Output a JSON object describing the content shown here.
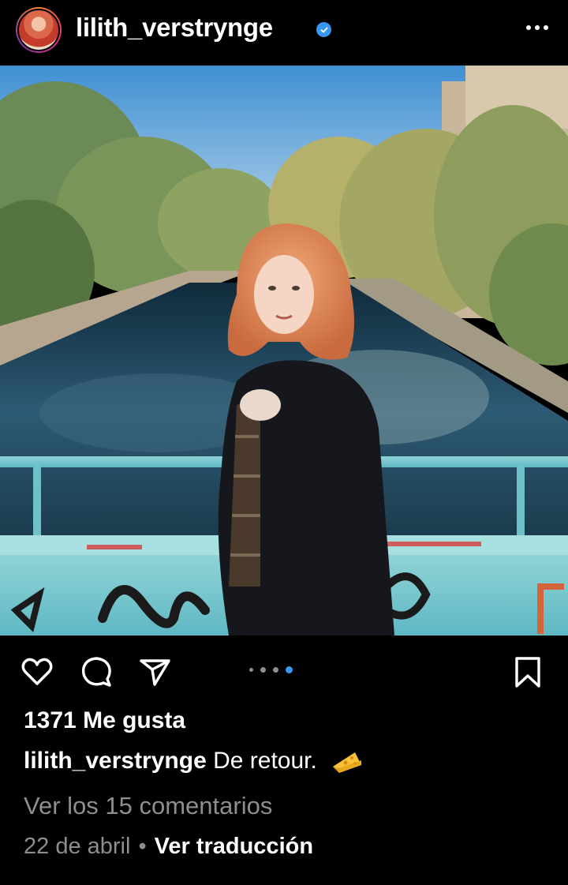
{
  "post": {
    "username": "lilith_verstrynge",
    "verified": true,
    "likes_text": "1371 Me gusta",
    "caption_text": "De retour.",
    "caption_emoji": "cheese-icon",
    "comments_link": "Ver los 15 comentarios",
    "date": "22 de abril",
    "separator": "•",
    "translate_link": "Ver traducción",
    "carousel": {
      "total": 4,
      "active_index": 3
    }
  },
  "colors": {
    "background": "#000000",
    "verified_blue": "#3897f0",
    "muted_text": "#8e8e8e"
  },
  "icons": [
    "more-icon",
    "heart-icon",
    "comment-icon",
    "share-icon",
    "bookmark-icon",
    "verified-icon"
  ]
}
